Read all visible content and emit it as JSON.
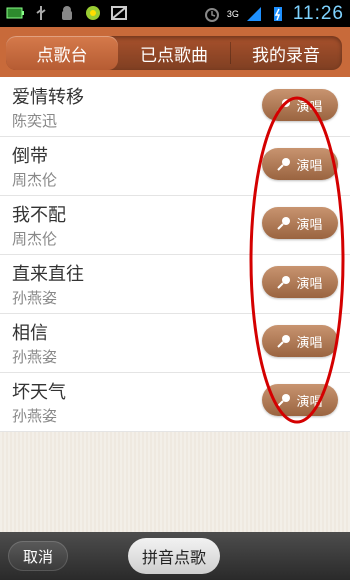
{
  "status_bar": {
    "time": "11:26",
    "network": "3G",
    "icons": [
      "battery-full-icon",
      "usb-icon",
      "android-debug-icon",
      "app-icon",
      "image-icon",
      "alarm-icon",
      "signal-icon",
      "charging-icon"
    ]
  },
  "tabs": [
    {
      "label": "点歌台",
      "active": true
    },
    {
      "label": "已点歌曲",
      "active": false
    },
    {
      "label": "我的录音",
      "active": false
    }
  ],
  "songs": [
    {
      "title": "爱情转移",
      "artist": "陈奕迅",
      "action": "演唱"
    },
    {
      "title": "倒带",
      "artist": "周杰伦",
      "action": "演唱"
    },
    {
      "title": "我不配",
      "artist": "周杰伦",
      "action": "演唱"
    },
    {
      "title": "直来直往",
      "artist": "孙燕姿",
      "action": "演唱"
    },
    {
      "title": "相信",
      "artist": "孙燕姿",
      "action": "演唱"
    },
    {
      "title": "坏天气",
      "artist": "孙燕姿",
      "action": "演唱"
    }
  ],
  "bottom_bar": {
    "cancel_label": "取消",
    "pinyin_label": "拼音点歌"
  },
  "colors": {
    "tab_bar": "#c86a3a",
    "sing_button": "#b07a55",
    "annotation": "#d40000"
  }
}
